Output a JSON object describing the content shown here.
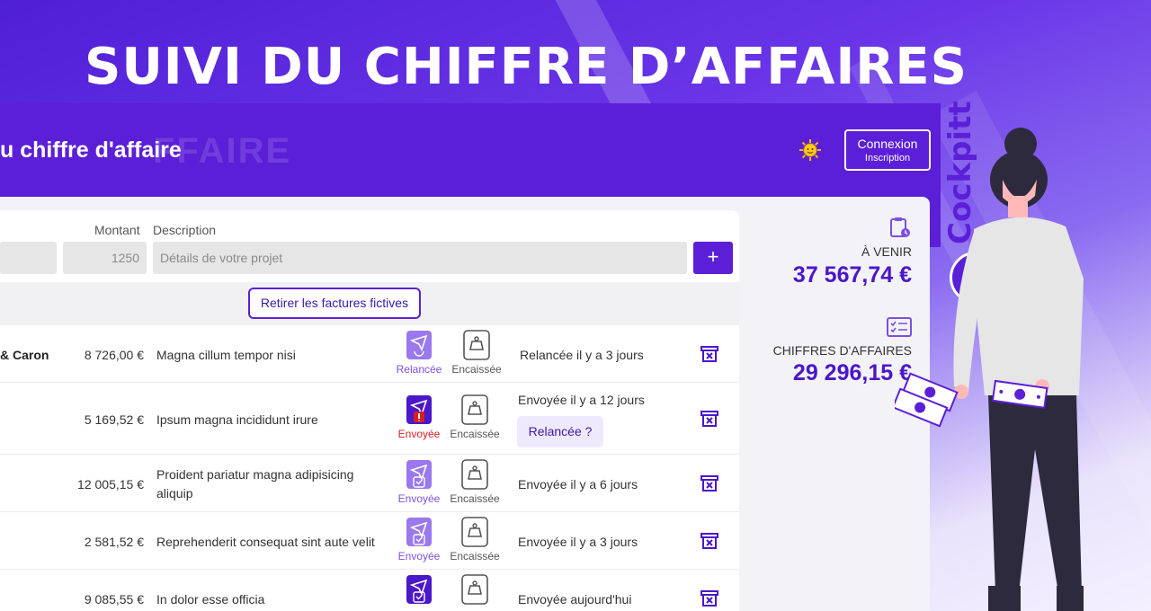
{
  "banner": {
    "headline": "SUIVI DU CHIFFRE D’AFFAIRES"
  },
  "header": {
    "title": "u chiffre d'affaire",
    "title_ghost": "FFAIRE",
    "auth": {
      "login": "Connexion",
      "signup": "Inscription"
    }
  },
  "form": {
    "amount_label": "Montant",
    "description_label": "Description",
    "amount_value": "1250",
    "description_placeholder": "Détails de votre projet",
    "add_label": "+"
  },
  "filter": {
    "label": "Retirer les factures fictives"
  },
  "rows": [
    {
      "client": "& Caron",
      "amount": "8 726,00 €",
      "description": "Magna cillum tempor nisi",
      "sent_status": "Relancée",
      "paid_status": "Encaissée",
      "info": "Relancée il y a 3 jours",
      "action": ""
    },
    {
      "client": "",
      "amount": "5 169,52 €",
      "description": "Ipsum magna incididunt irure",
      "sent_status": "Envoyée",
      "paid_status": "Encaissée",
      "info": "Envoyée il y a 12 jours",
      "action": "Relancée ?"
    },
    {
      "client": "",
      "amount": "12 005,15 €",
      "description": "Proident pariatur magna adipisicing aliquip",
      "sent_status": "Envoyée",
      "paid_status": "Encaissée",
      "info": "Envoyée il y a 6 jours",
      "action": ""
    },
    {
      "client": "",
      "amount": "2 581,52 €",
      "description": "Reprehenderit consequat sint aute velit",
      "sent_status": "Envoyée",
      "paid_status": "Encaissée",
      "info": "Envoyée il y a 3 jours",
      "action": ""
    },
    {
      "client": "",
      "amount": "9 085,55 €",
      "description": "In dolor esse officia",
      "sent_status": "",
      "paid_status": "",
      "info": "Envoyée aujourd'hui",
      "action": ""
    }
  ],
  "kpis": {
    "upcoming": {
      "label": "À VENIR",
      "value": "37 567,74 €"
    },
    "revenue": {
      "label": "CHIFFRES D'AFFAIRES",
      "value": "29 296,15 €"
    }
  },
  "brand": {
    "name": "Cockpitt"
  },
  "colors": {
    "primary": "#5b1fd7",
    "accent_text": "#4a17c9",
    "alert": "#d62020"
  }
}
